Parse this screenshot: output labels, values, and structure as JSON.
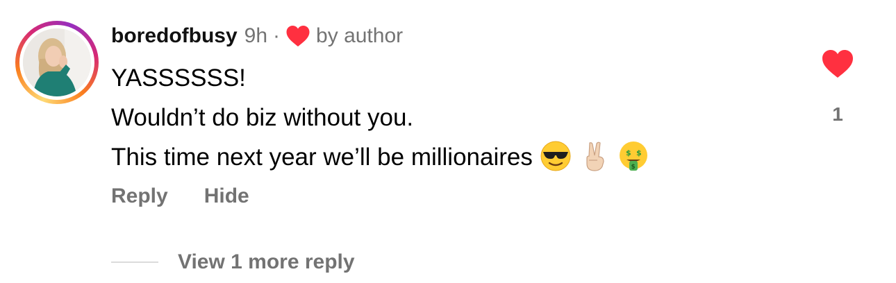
{
  "comment": {
    "username": "boredofbusy",
    "time": "9h",
    "separator": "·",
    "liked_by_author_label": "by author",
    "lines": [
      "YASSSSSS!",
      "Wouldn’t do biz without you.",
      "This time next year we’ll be millionaires"
    ],
    "emojis": [
      "smiling-face-with-sunglasses",
      "victory-hand-light-skin-tone",
      "money-mouth-face"
    ],
    "like_count": "1",
    "liked": true,
    "avatar_ring": "story-gradient"
  },
  "actions": {
    "reply_label": "Reply",
    "hide_label": "Hide"
  },
  "replies": {
    "view_more_label": "View 1 more reply"
  },
  "colors": {
    "heart_red": "#ff3040",
    "meta_gray": "#737373",
    "text": "#000000",
    "divider": "#dbdbdb"
  }
}
